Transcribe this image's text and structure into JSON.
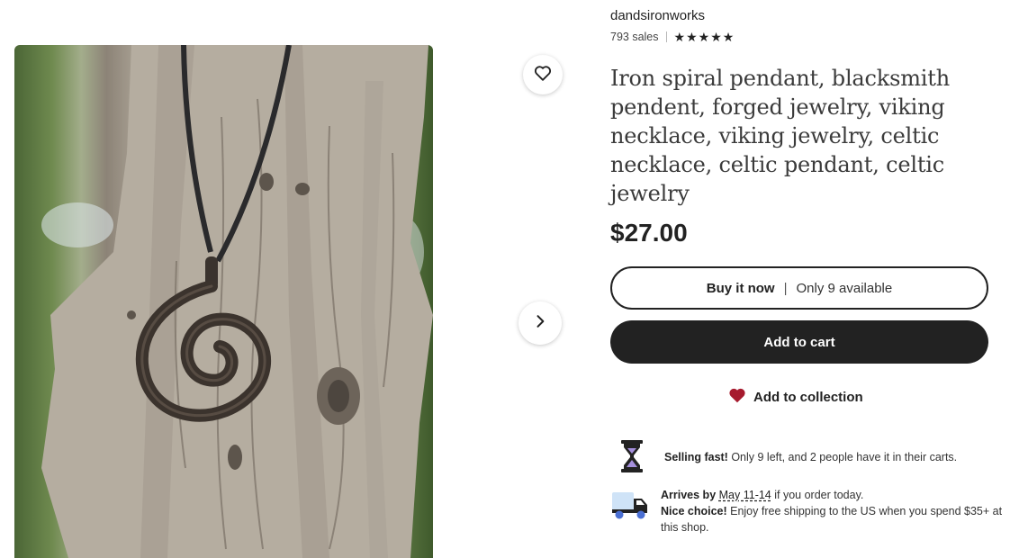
{
  "shop": {
    "name": "dandsironworks",
    "sales": "793 sales",
    "rating": 5
  },
  "product": {
    "title": "Iron spiral pendant, blacksmith pendent, forged jewelry, viking necklace, viking jewelry, celtic necklace, celtic pendant, celtic jewelry",
    "price": "$27.00"
  },
  "actions": {
    "buy_now": "Buy it now",
    "divider": "|",
    "availability": "Only 9 available",
    "add_to_cart": "Add to cart",
    "add_to_collection": "Add to collection"
  },
  "selling_fast": {
    "bold": "Selling fast!",
    "text": " Only 9 left, and 2 people have it in their carts."
  },
  "shipping": {
    "arrives_prefix": "Arrives by ",
    "arrives_date": "May 11-14",
    "arrives_suffix": " if you order today.",
    "nice_bold": "Nice choice!",
    "nice_text": " Enjoy free shipping to the US when you spend $35+ at this shop."
  },
  "icons": {
    "favorite": "heart-outline-icon",
    "next": "chevron-right-icon",
    "star": "star-icon",
    "collection": "heart-filled-icon",
    "selling_fast": "hourglass-icon",
    "shipping": "delivery-truck-icon"
  },
  "colors": {
    "primary": "#222222",
    "heart": "#a61a2e",
    "hourglass_sand": "#a58fdc",
    "truck_box": "#cfe3f7",
    "truck_wheels": "#4a6fd3"
  }
}
